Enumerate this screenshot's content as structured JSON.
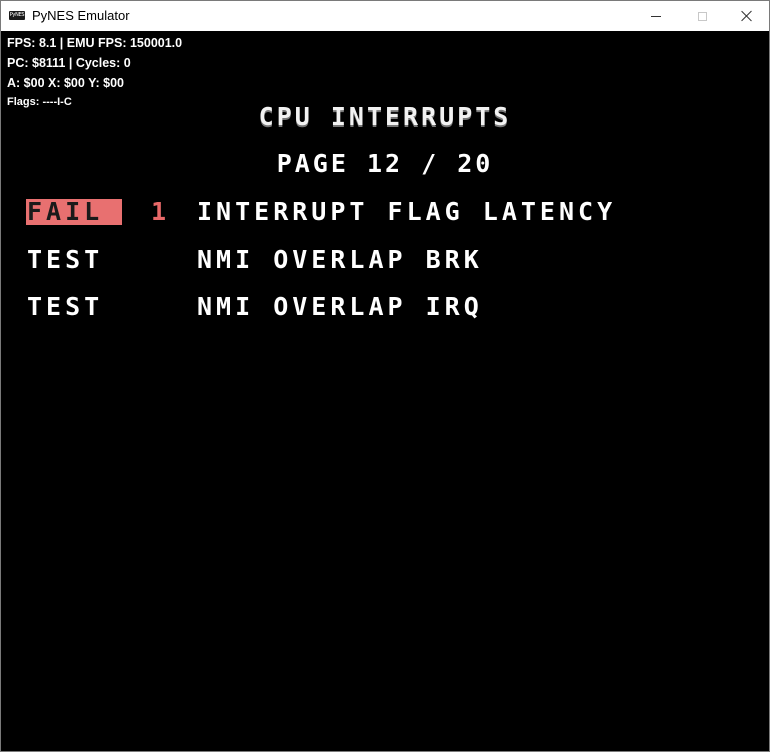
{
  "window": {
    "title": "PyNES Emulator",
    "icon_text": "PyNES"
  },
  "hud": {
    "fps_line": "FPS: 8.1 | EMU FPS: 150001.0",
    "pc_line": "PC: $8111 | Cycles: 0",
    "regs_line": "A: $00 X: $00 Y: $00",
    "flags_line": "Flags: ----I-C"
  },
  "nes_screen": {
    "header": "CPU INTERRUPTS",
    "page": "PAGE 12 / 20",
    "rows": [
      {
        "status": "FAIL",
        "code": "1",
        "description": "INTERRUPT FLAG LATENCY"
      },
      {
        "status": "TEST",
        "code": "",
        "description": "NMI OVERLAP BRK"
      },
      {
        "status": "TEST",
        "code": "",
        "description": "NMI OVERLAP IRQ"
      }
    ]
  },
  "colors": {
    "fail_highlight": "#e87070",
    "screen_background": "#000000",
    "text": "#ffffff"
  }
}
